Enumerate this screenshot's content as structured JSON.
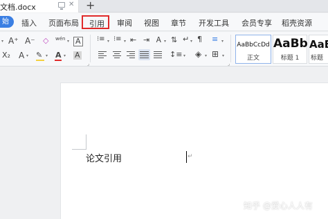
{
  "titlebar": {
    "doc_title": "文档.docx",
    "close_glyph": "✕",
    "new_tab_glyph": "+"
  },
  "menu": {
    "start_label": "始",
    "items": [
      "插入",
      "页面布局",
      "引用",
      "审阅",
      "视图",
      "章节",
      "开发工具",
      "会员专享",
      "稻壳资源"
    ],
    "highlighted_index": 2,
    "highlight_color": "#e02a2a",
    "start_color": "#3b7fe3"
  },
  "ribbon": {
    "row1": {
      "increase_font_glyph": "A⁺",
      "decrease_font_glyph": "A⁻",
      "clear_format_glyph": "◇",
      "pinyin_glyph": "wén",
      "char_border_glyph": "A"
    },
    "row2": {
      "subscript_glyph": "X₂",
      "text_effect_glyph": "A",
      "highlight_glyph": "✎",
      "font_color_glyph": "A",
      "char_shading_glyph": "A"
    },
    "styles": [
      {
        "sample": "AaBbCcDd",
        "label": "正文"
      },
      {
        "sample": "AaBb",
        "label": "标题 1"
      },
      {
        "sample": "AaBl",
        "label": "标题"
      }
    ],
    "font_color": "#e02a2a",
    "highlight_color": "#f4d03f",
    "active_align_bg": "#dbe4f2"
  },
  "document": {
    "body_text": "论文引用",
    "paragraph_mark": "↵"
  },
  "watermark": {
    "text": "知乎 @爱心人人有"
  }
}
